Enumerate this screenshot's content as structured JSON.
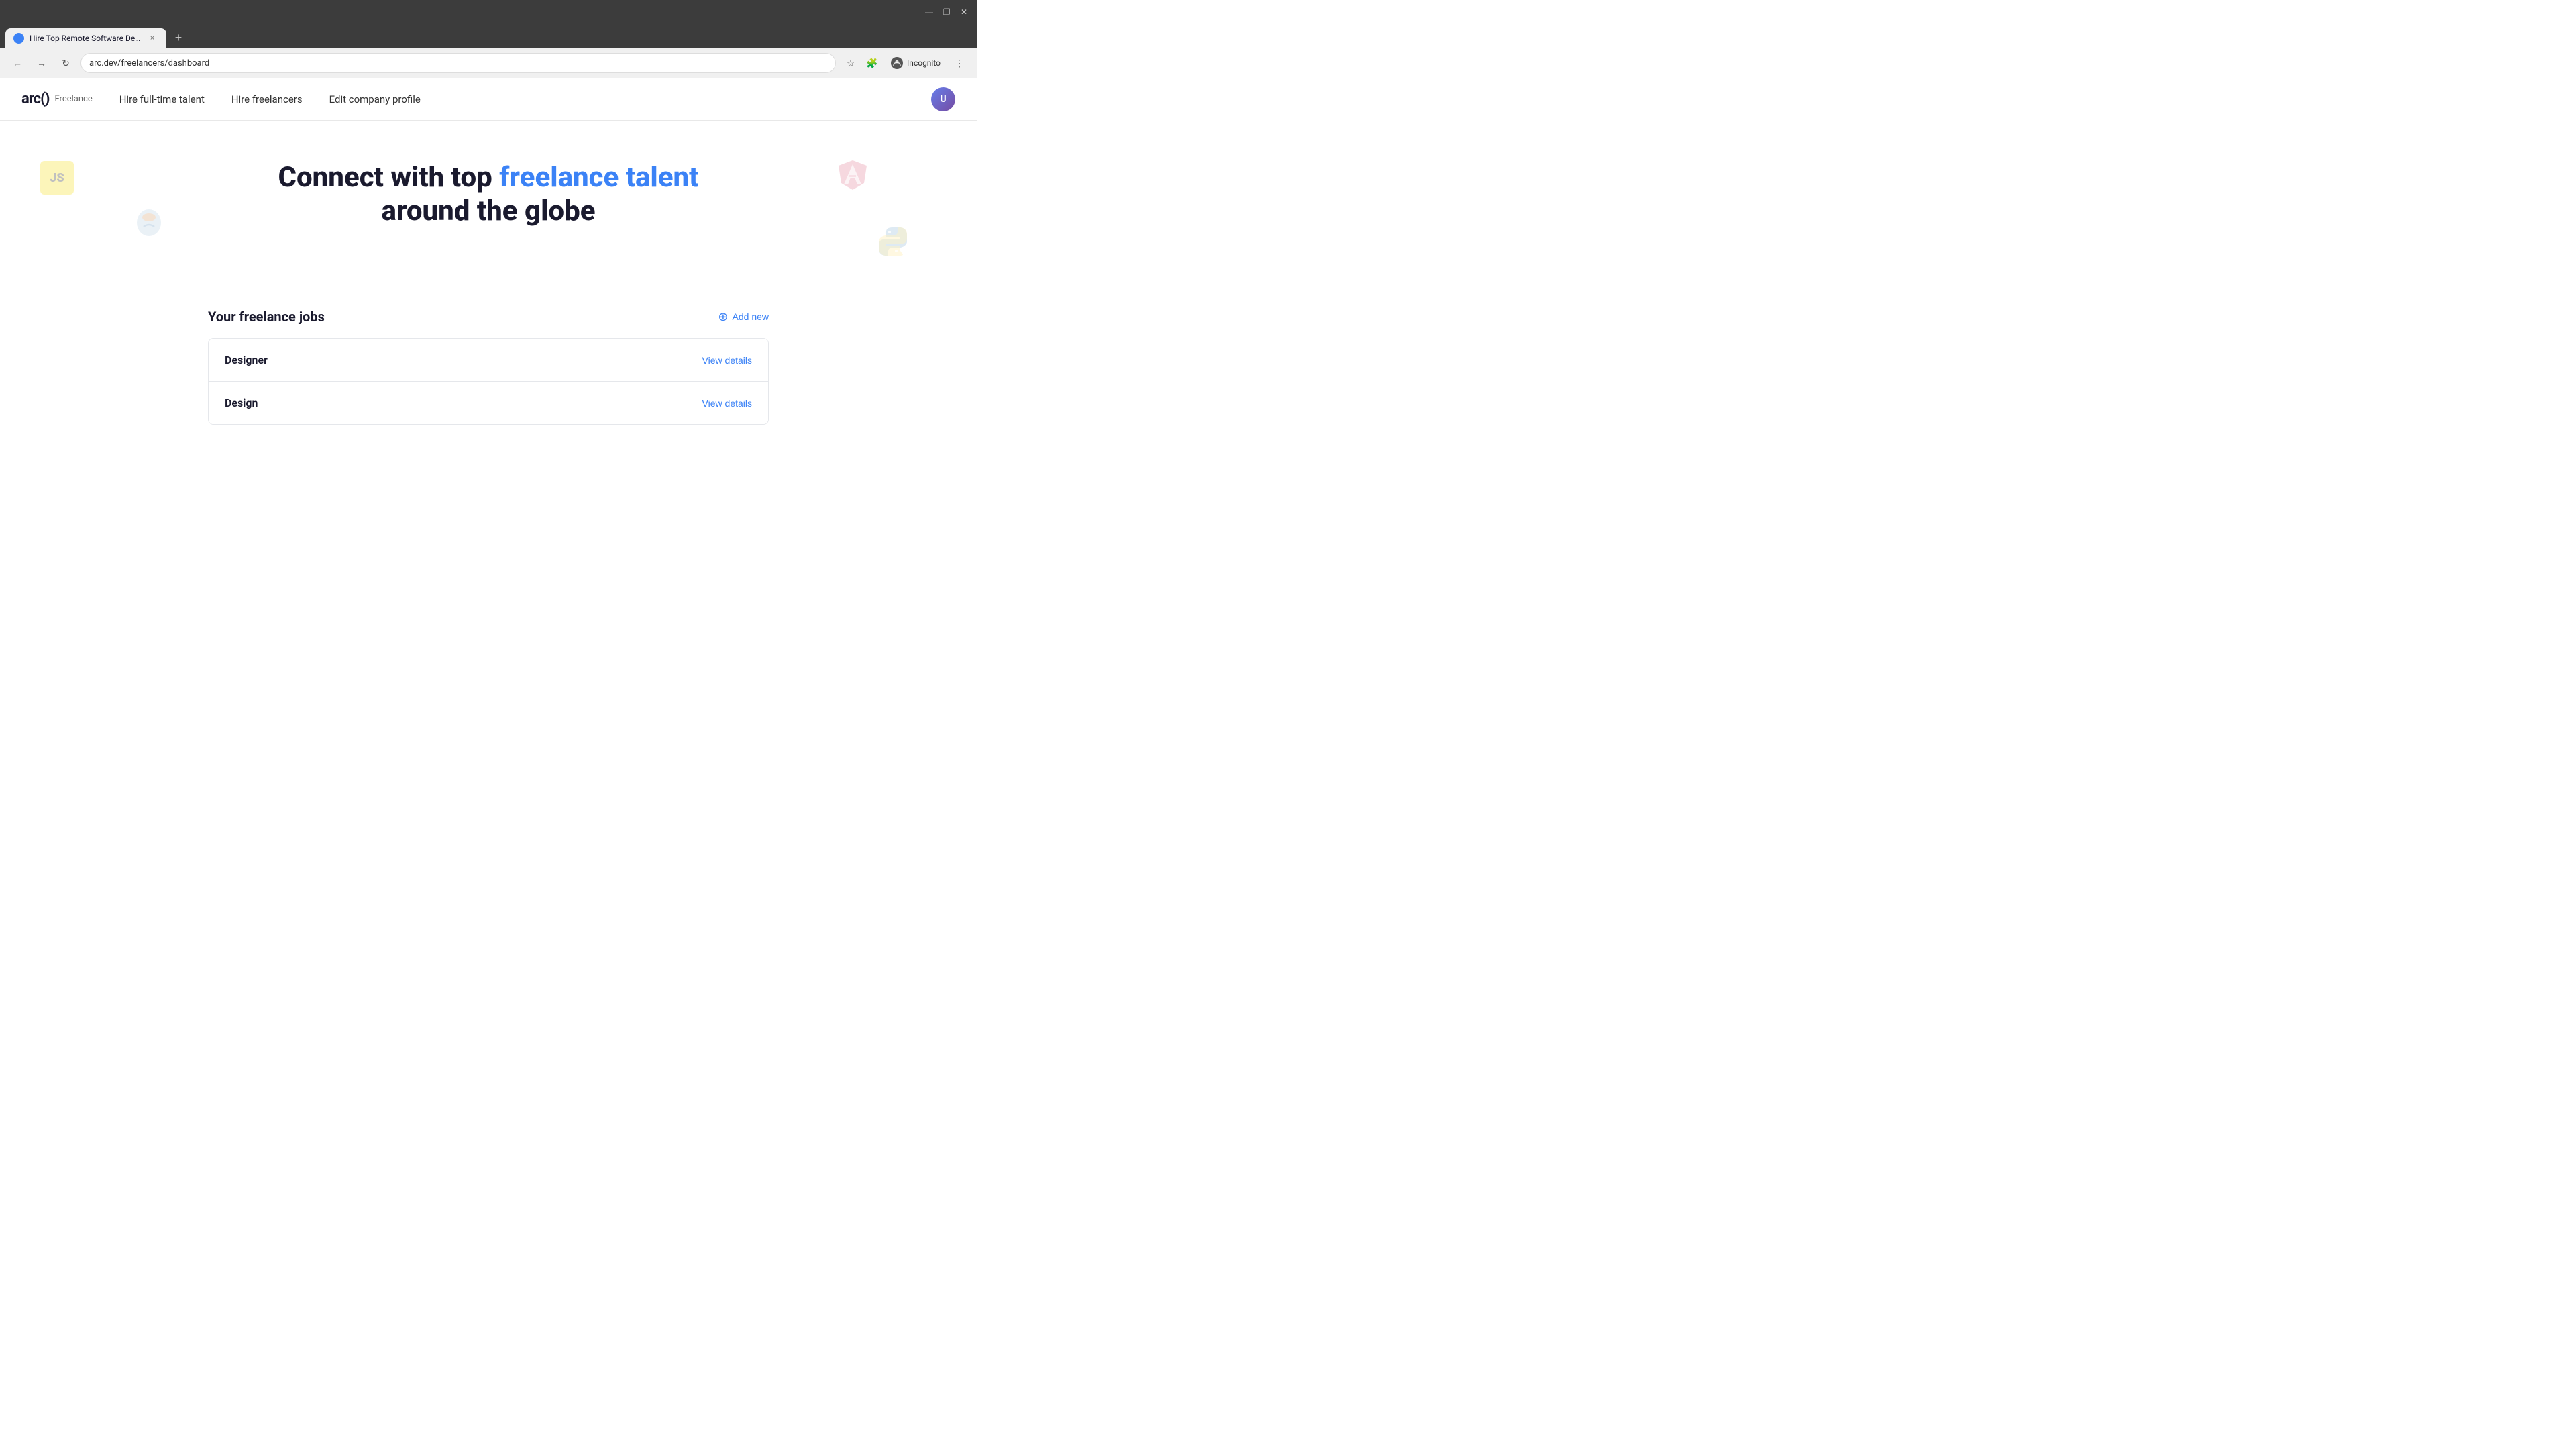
{
  "browser": {
    "tab_title": "Hire Top Remote Software Dev...",
    "tab_favicon": "arc-favicon",
    "url": "arc.dev/freelancers/dashboard",
    "new_tab_label": "+",
    "close_tab_label": "×",
    "back_btn": "←",
    "forward_btn": "→",
    "refresh_btn": "↻",
    "incognito_label": "Incognito",
    "bookmark_icon": "☆",
    "extensions_icon": "🧩",
    "more_icon": "⋮",
    "window_minimize": "—",
    "window_maximize": "❐",
    "window_close": "✕"
  },
  "nav": {
    "logo_text": "arc()",
    "logo_subtitle": "Freelance",
    "links": [
      {
        "label": "Hire full-time talent",
        "key": "hire-fulltime"
      },
      {
        "label": "Hire freelancers",
        "key": "hire-freelancers"
      },
      {
        "label": "Edit company profile",
        "key": "edit-profile"
      }
    ],
    "avatar_initials": "U"
  },
  "hero": {
    "title_prefix": "Connect with top ",
    "title_highlight": "freelance talent",
    "title_suffix": " around the globe",
    "icons": {
      "js": "JS",
      "python": "🐍",
      "angular": "Δ",
      "java": "☕"
    }
  },
  "jobs_section": {
    "title": "Your freelance jobs",
    "add_new_label": "Add new",
    "jobs": [
      {
        "name": "Designer",
        "view_label": "View details"
      },
      {
        "name": "Design",
        "view_label": "View details"
      }
    ]
  }
}
